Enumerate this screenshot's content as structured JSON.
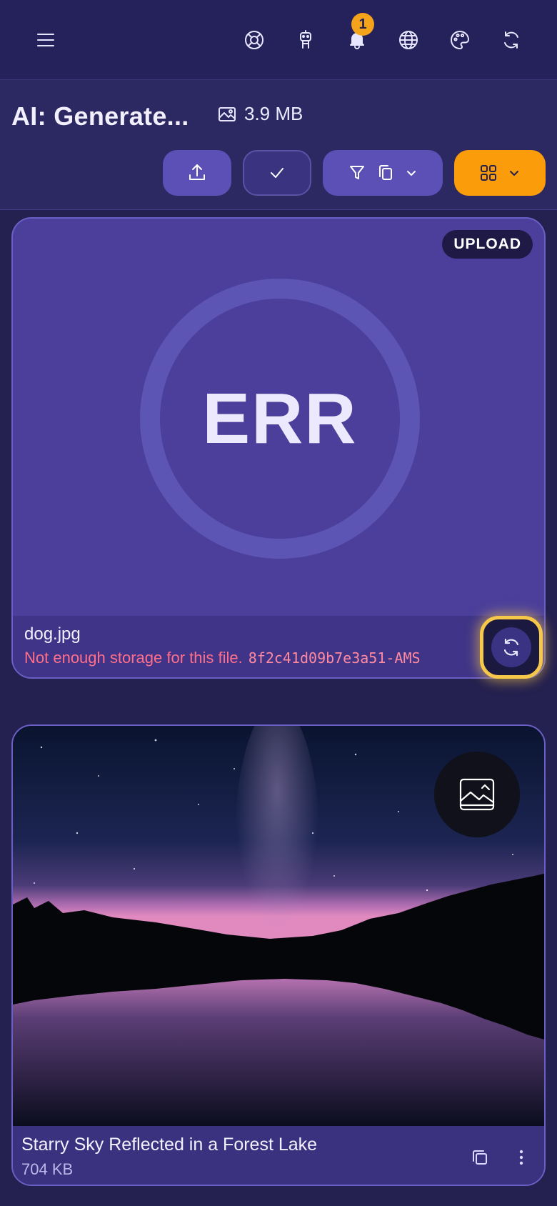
{
  "header": {
    "menu_icon": "menu-icon",
    "actions": [
      "help-icon",
      "robot-icon",
      "bell-icon",
      "globe-icon",
      "palette-icon",
      "refresh-icon"
    ],
    "notification_count": "1"
  },
  "page": {
    "title": "AI: Generate...",
    "size_icon": "image-icon",
    "size": "3.9 MB"
  },
  "toolbar": {
    "upload_icon": "upload-icon",
    "select_icon": "check-icon",
    "filter_icons": [
      "filter-icon",
      "copy-icon",
      "chevron-down-icon"
    ],
    "view_icons": [
      "grid-icon",
      "chevron-down-icon"
    ]
  },
  "cards": [
    {
      "badge": "UPLOAD",
      "status": "ERR",
      "file_name": "dog.jpg",
      "error_message": "Not enough storage for this file.",
      "error_code": "8f2c41d09b7e3a51-AMS",
      "retry_icon": "refresh-icon"
    },
    {
      "type_icon": "image-icon",
      "title": "Starry Sky Reflected in a Forest Lake",
      "size": "704 KB",
      "actions": [
        "copy-icon",
        "more-vertical-icon"
      ]
    }
  ],
  "colors": {
    "background": "#24204f",
    "accent": "#fb9d0b",
    "error": "#ff6f8a",
    "focus_ring": "#f6c84a"
  }
}
